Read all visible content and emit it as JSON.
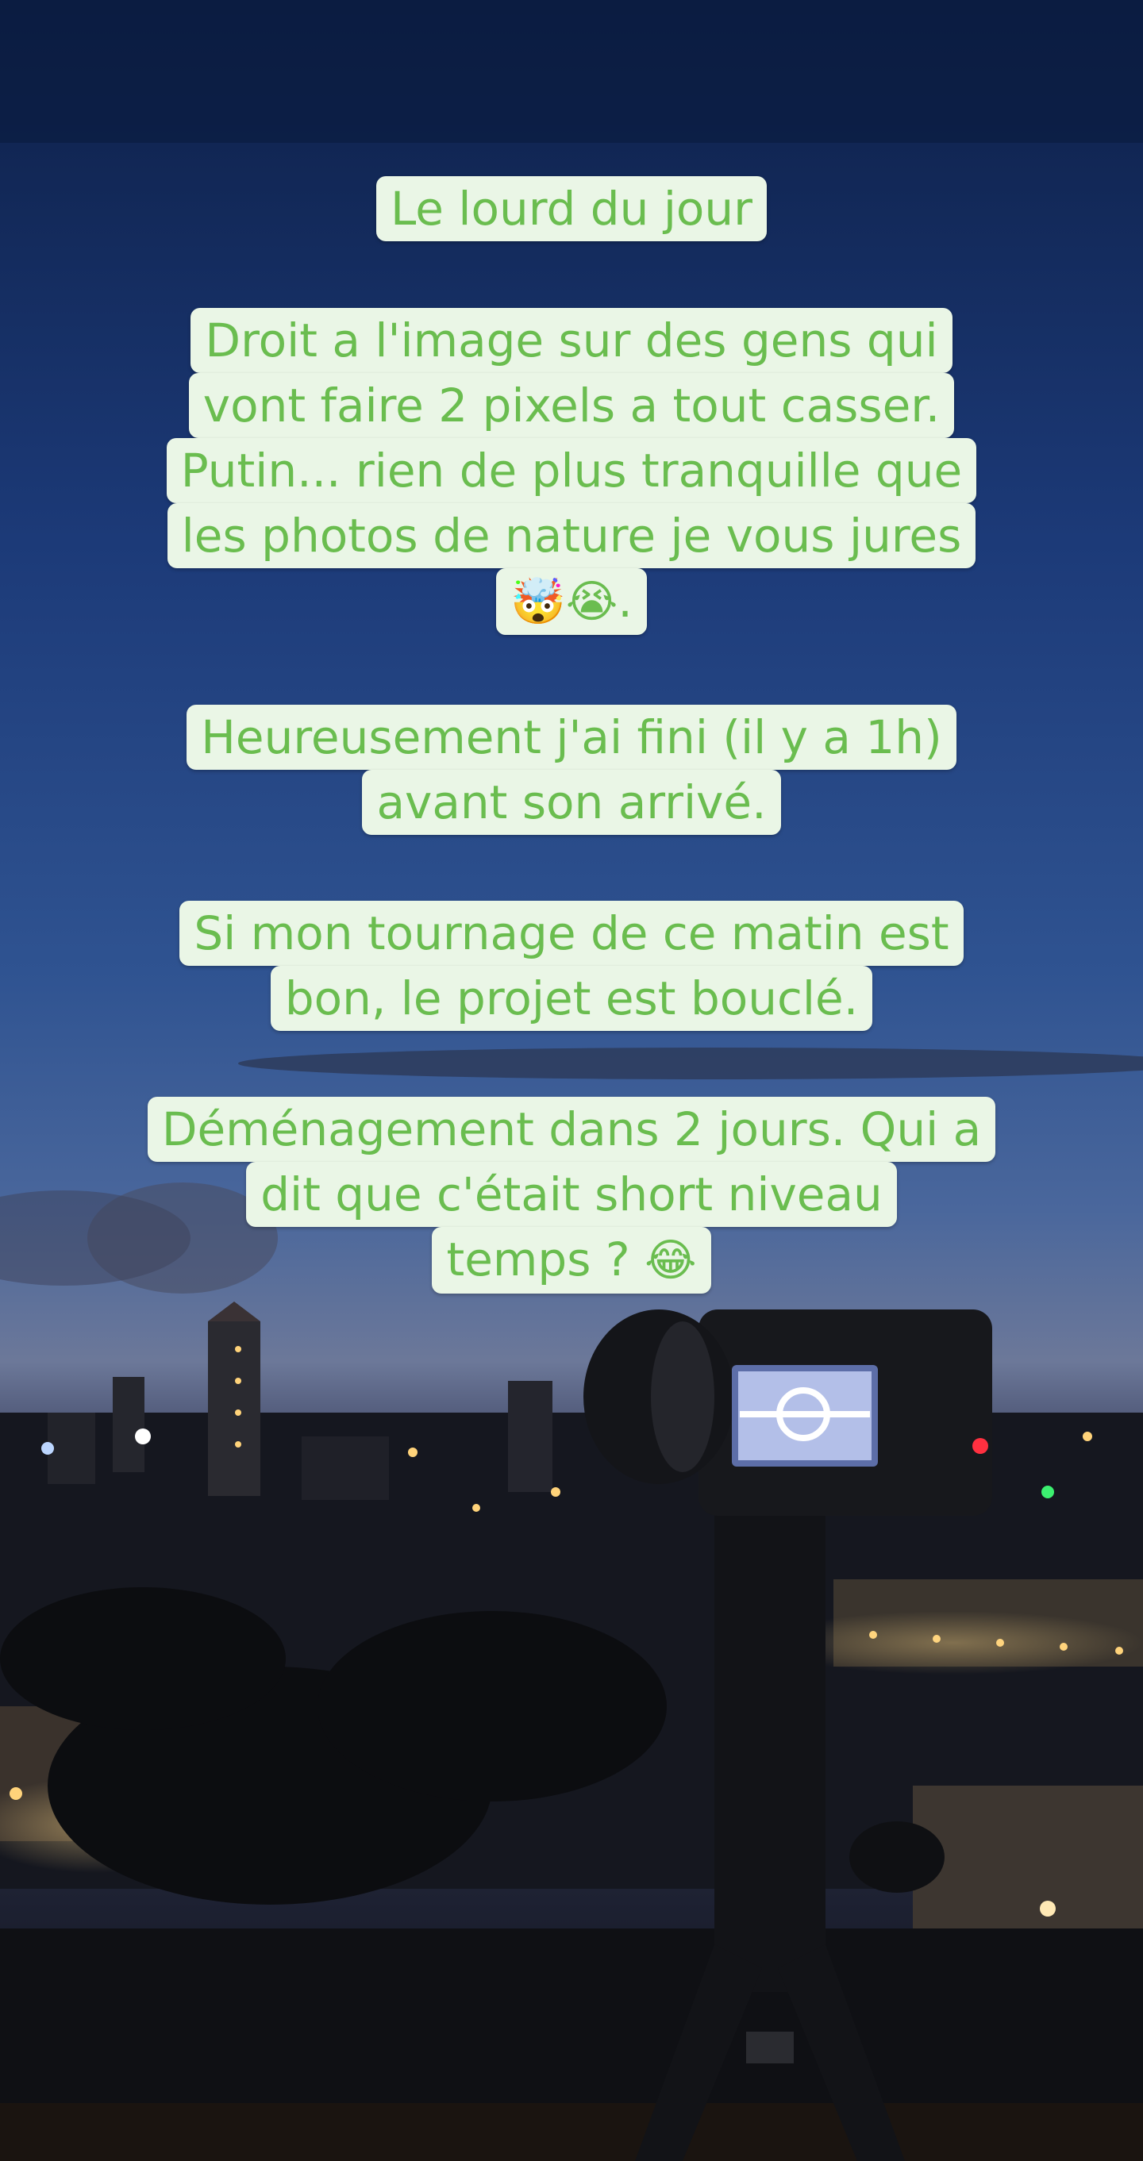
{
  "story": {
    "captions": [
      {
        "lines": [
          "Le lourd du jour"
        ]
      },
      {
        "lines": [
          "Droit a l'image sur des gens qui",
          "vont faire 2 pixels a tout casser.",
          "Putin... rien de plus tranquille que",
          "les photos de nature je vous jures"
        ],
        "emoji_line": {
          "emojis": [
            "🤯",
            "😭"
          ],
          "suffix": "."
        }
      },
      {
        "lines": [
          "Heureusement j'ai fini (il y a 1h)",
          "avant son arrivé."
        ]
      },
      {
        "lines": [
          "Si mon tournage de ce matin est",
          "bon, le projet est bouclé."
        ]
      },
      {
        "lines": [
          "Déménagement dans 2 jours. Qui a",
          "dit que c'était short niveau"
        ],
        "emoji_line": {
          "text": "temps ? ",
          "emojis": [
            "😂"
          ]
        }
      }
    ],
    "colors": {
      "caption_text": "#6abd4f",
      "caption_bg": "#eaf6e6",
      "sky_top": "#0e2350",
      "sky_mid": "#2e4f8c",
      "horizon": "#8a8fa8"
    }
  }
}
